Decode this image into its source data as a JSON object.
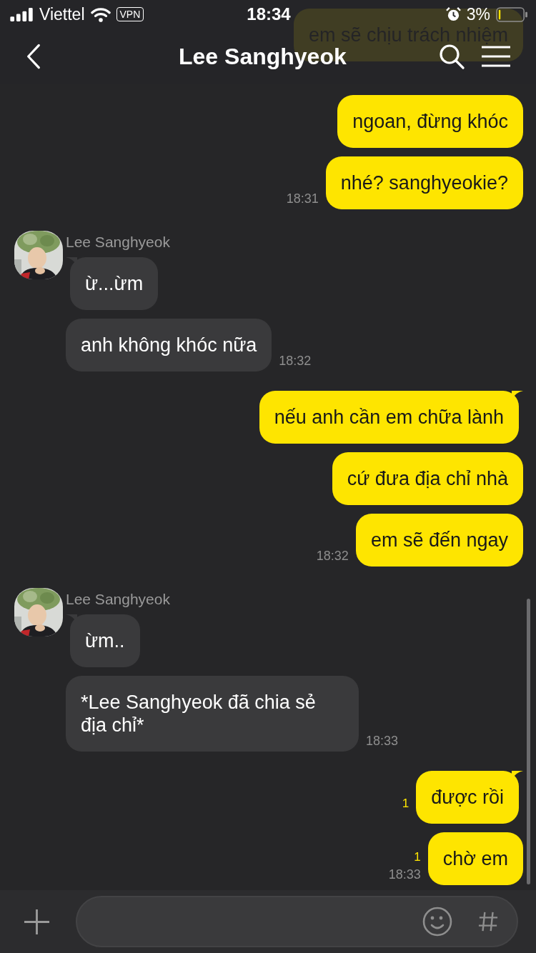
{
  "status_bar": {
    "carrier": "Viettel",
    "vpn": "VPN",
    "time": "18:34",
    "battery": "3%"
  },
  "header": {
    "title": "Lee Sanghyeok"
  },
  "groups": [
    {
      "kind": "me",
      "messages": [
        {
          "text": "em sẽ chịu trách nhiệm",
          "tail": false
        }
      ]
    },
    {
      "kind": "me",
      "messages": [
        {
          "text": "ngoan, đừng khóc",
          "tail": false
        },
        {
          "text": "nhé? sanghyeokie?",
          "tail": false,
          "time": "18:31"
        }
      ]
    },
    {
      "kind": "them",
      "name": "Lee Sanghyeok",
      "messages": [
        {
          "text": "ừ...ừm",
          "tail": true
        },
        {
          "text": "anh không khóc nữa",
          "tail": false,
          "time": "18:32"
        }
      ]
    },
    {
      "kind": "me",
      "messages": [
        {
          "text": "nếu anh cần em chữa lành",
          "tail": true
        },
        {
          "text": "cứ đưa địa chỉ nhà",
          "tail": false
        },
        {
          "text": "em sẽ đến ngay",
          "tail": false,
          "time": "18:32"
        }
      ]
    },
    {
      "kind": "them",
      "name": "Lee Sanghyeok",
      "messages": [
        {
          "text": "ừm..",
          "tail": true
        },
        {
          "text": "*Lee Sanghyeok đã chia sẻ địa chỉ*",
          "tail": false,
          "time": "18:33"
        }
      ]
    },
    {
      "kind": "me",
      "messages": [
        {
          "text": "được rồi",
          "tail": true,
          "unread": "1"
        },
        {
          "text": "chờ em",
          "tail": false,
          "unread": "1",
          "time": "18:33"
        }
      ]
    }
  ]
}
